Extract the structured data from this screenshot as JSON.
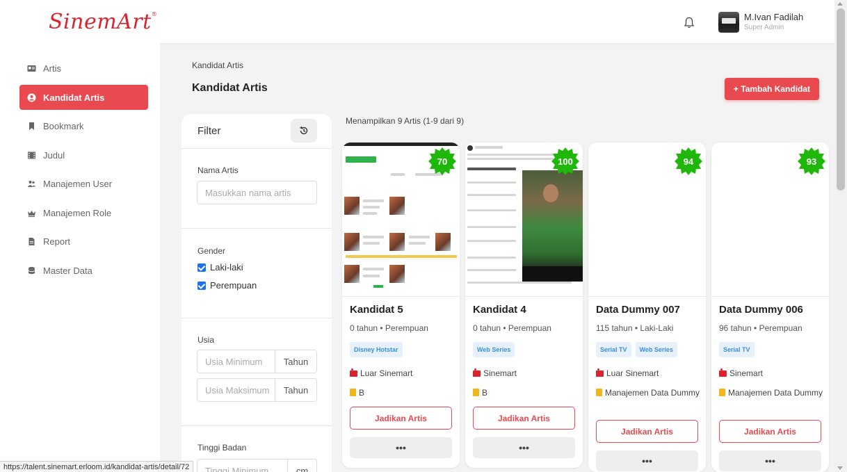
{
  "header": {
    "logo_text": "SinemArt",
    "logo_mark": "®",
    "user_name": "M.Ivan Fadilah",
    "user_role": "Super Admin",
    "bell_icon": "bell-icon"
  },
  "sidebar": {
    "items": [
      {
        "label": "Artis",
        "icon": "id-card-icon",
        "active": false
      },
      {
        "label": "Kandidat Artis",
        "icon": "user-circle-icon",
        "active": true
      },
      {
        "label": "Bookmark",
        "icon": "bookmark-icon",
        "active": false
      },
      {
        "label": "Judul",
        "icon": "film-icon",
        "active": false
      },
      {
        "label": "Manajemen User",
        "icon": "users-icon",
        "active": false
      },
      {
        "label": "Manajemen Role",
        "icon": "crown-icon",
        "active": false
      },
      {
        "label": "Report",
        "icon": "file-icon",
        "active": false
      },
      {
        "label": "Master Data",
        "icon": "database-icon",
        "active": false
      }
    ]
  },
  "page": {
    "breadcrumb": "Kandidat Artis",
    "title": "Kandidat Artis",
    "add_button": "+ Tambah Kandidat",
    "result_info": "Menampilkan 9 Artis (1-9 dari 9)"
  },
  "filter": {
    "title": "Filter",
    "name_label": "Nama Artis",
    "name_placeholder": "Masukkan nama artis",
    "gender_label": "Gender",
    "gender_options": [
      "Laki-laki",
      "Perempuan"
    ],
    "age_label": "Usia",
    "age_min_placeholder": "Usia Minimum",
    "age_max_placeholder": "Usia Maksimum",
    "age_unit": "Tahun",
    "height_label": "Tinggi Badan",
    "height_min_placeholder": "Tinggi Minimum",
    "height_unit": "cm"
  },
  "cards": [
    {
      "score": "70",
      "name": "Kandidat 5",
      "meta": "0 tahun • Perempuan",
      "tags": [
        "Disney Hotstar"
      ],
      "location": "Luar Sinemart",
      "owner": "B",
      "cta": "Jadikan Artis",
      "more": "•••"
    },
    {
      "score": "100",
      "name": "Kandidat 4",
      "meta": "0 tahun • Perempuan",
      "tags": [
        "Web Series"
      ],
      "location": "Sinemart",
      "owner": "B",
      "cta": "Jadikan Artis",
      "more": "•••"
    },
    {
      "score": "94",
      "name": "Data Dummy 007",
      "meta": "115 tahun • Laki-Laki",
      "tags": [
        "Serial TV",
        "Web Series"
      ],
      "location": "Luar Sinemart",
      "owner": "Manajemen Data Dummy",
      "cta": "Jadikan Artis",
      "more": "•••"
    },
    {
      "score": "93",
      "name": "Data Dummy 006",
      "meta": "96 tahun • Perempuan",
      "tags": [
        "Serial TV"
      ],
      "location": "Sinemart",
      "owner": "Manajemen Data Dummy",
      "cta": "Jadikan Artis",
      "more": "•••"
    }
  ],
  "status_bar": {
    "url": "https://talent.sinemart.erloom.id/kandidat-artis/detail/72"
  },
  "colors": {
    "brand": "#d9232d",
    "accent": "#e94a50",
    "badge": "#1fb80a",
    "tag_bg": "#e7f1fb",
    "tag_text": "#3b8ee0"
  }
}
